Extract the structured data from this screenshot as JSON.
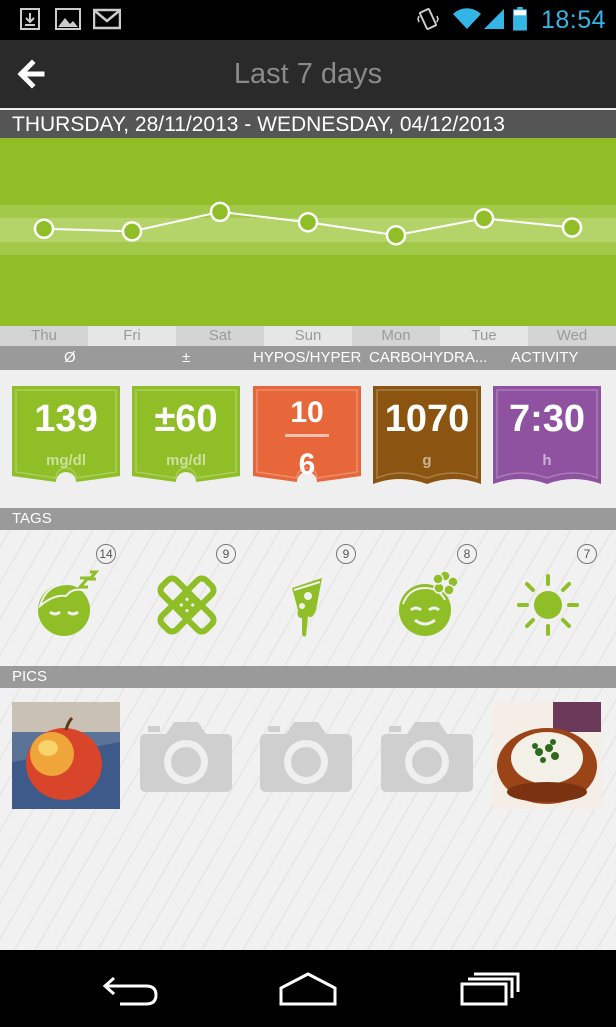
{
  "status_bar": {
    "time": "18:54",
    "left_icons": [
      "download-icon",
      "image-icon",
      "gmail-icon"
    ],
    "right_icons": [
      "vibrate-icon",
      "wifi-icon",
      "signal-icon",
      "battery-icon"
    ]
  },
  "action_bar": {
    "title": "Last 7 days"
  },
  "date_range": "THURSDAY, 28/11/2013 - WEDNESDAY, 04/12/2013",
  "chart_data": {
    "type": "line",
    "categories": [
      "Thu",
      "Fri",
      "Sat",
      "Sun",
      "Mon",
      "Tue",
      "Wed"
    ],
    "series": [
      {
        "values": [
          145,
          143,
          158,
          150,
          140,
          153,
          146
        ]
      }
    ],
    "ylim": [
      70,
      215
    ],
    "grid": false
  },
  "metric_header": {
    "avg": "Ø",
    "spread": "±",
    "hypos": "HYPOS/HYPER",
    "carbs": "CARBOHYDRA...",
    "activity": "ACTIVITY"
  },
  "metrics": {
    "glucose": {
      "value": "139",
      "unit": "mg/dl",
      "color": "#8fbe27"
    },
    "spread": {
      "value": "±60",
      "unit": "mg/dl",
      "color": "#8fbe27"
    },
    "hypos_hyper": {
      "top": "10",
      "bottom": "6",
      "color": "#e8673a"
    },
    "carbs": {
      "value": "1070",
      "unit": "g",
      "color": "#8b5410"
    },
    "activity": {
      "value": "7:30",
      "unit": "h",
      "color": "#8e52a1"
    }
  },
  "sections": {
    "tags": "TAGS",
    "pics": "PICS"
  },
  "tags": [
    {
      "icon": "sleep-face-icon",
      "count": "14"
    },
    {
      "icon": "bandage-icon",
      "count": "9"
    },
    {
      "icon": "pizza-slice-icon",
      "count": "9"
    },
    {
      "icon": "happy-face-flower-icon",
      "count": "8"
    },
    {
      "icon": "sun-icon",
      "count": "7"
    }
  ],
  "pics": [
    {
      "type": "photo",
      "subject": "apple"
    },
    {
      "type": "camera-placeholder"
    },
    {
      "type": "camera-placeholder"
    },
    {
      "type": "camera-placeholder"
    },
    {
      "type": "photo",
      "subject": "baked-potato"
    }
  ],
  "nav": [
    "back-nav-icon",
    "home-nav-icon",
    "recent-apps-icon"
  ]
}
